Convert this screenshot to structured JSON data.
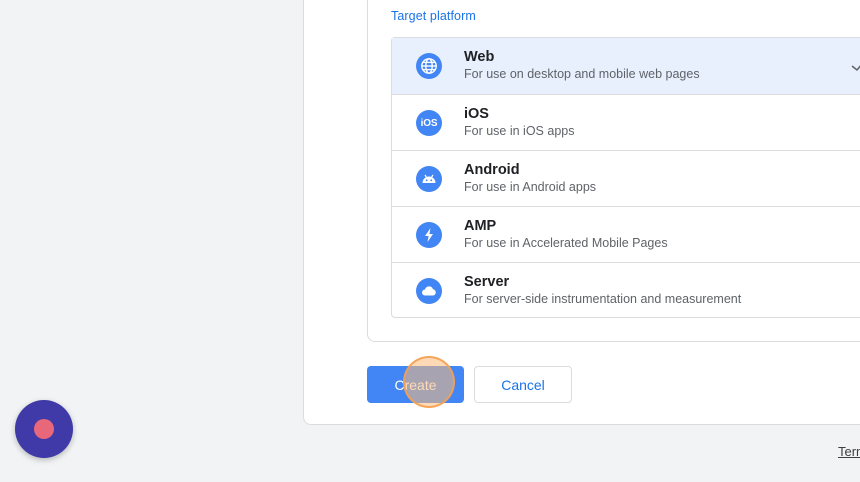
{
  "section": {
    "label": "Target platform"
  },
  "platforms": [
    {
      "title": "Web",
      "subtitle": "For use on desktop and mobile web pages",
      "icon": "globe-icon",
      "selected": true
    },
    {
      "title": "iOS",
      "subtitle": "For use in iOS apps",
      "icon": "ios-icon",
      "selected": false
    },
    {
      "title": "Android",
      "subtitle": "For use in Android apps",
      "icon": "android-icon",
      "selected": false
    },
    {
      "title": "AMP",
      "subtitle": "For use in Accelerated Mobile Pages",
      "icon": "lightning-icon",
      "selected": false
    },
    {
      "title": "Server",
      "subtitle": "For server-side instrumentation and measurement",
      "icon": "cloud-icon",
      "selected": false
    }
  ],
  "buttons": {
    "create": "Create",
    "cancel": "Cancel"
  },
  "footer": {
    "terms": "Terms"
  },
  "colors": {
    "accent": "#4285f4",
    "link": "#1a73e8",
    "selected_bg": "#e8f0fe",
    "fab": "#3f3aa8",
    "fab_dot": "#e8677a"
  }
}
